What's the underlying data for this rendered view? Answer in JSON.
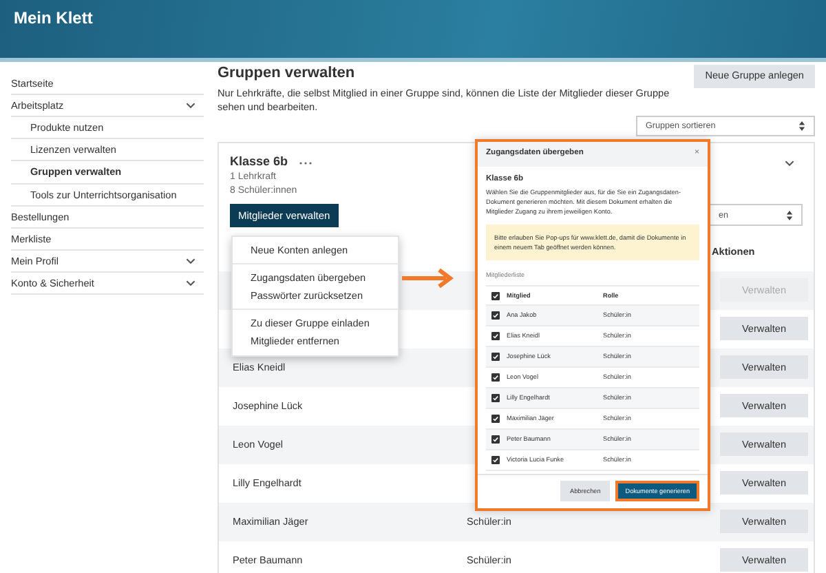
{
  "header": {
    "title": "Mein Klett"
  },
  "sidebar": {
    "items": [
      {
        "label": "Startseite",
        "kind": "link",
        "selected": false
      },
      {
        "label": "Arbeitsplatz",
        "kind": "group",
        "selected": false,
        "children": [
          {
            "label": "Produkte nutzen",
            "selected": false
          },
          {
            "label": "Lizenzen verwalten",
            "selected": false
          },
          {
            "label": "Gruppen verwalten",
            "selected": true
          },
          {
            "label": "Tools zur Unterrichtsorganisation",
            "selected": false
          }
        ]
      },
      {
        "label": "Bestellungen",
        "kind": "link",
        "selected": false
      },
      {
        "label": "Merkliste",
        "kind": "link",
        "selected": false
      },
      {
        "label": "Mein Profil",
        "kind": "group",
        "selected": false
      },
      {
        "label": "Konto & Sicherheit",
        "kind": "group",
        "selected": false
      }
    ]
  },
  "page": {
    "title": "Gruppen verwalten",
    "description": "Nur Lehrkräfte, die selbst Mitglied in einer Gruppe sind, können die Liste der Mitglieder dieser Gruppe sehen und bearbeiten.",
    "new_group_button": "Neue Gruppe anlegen",
    "sort_select": "Gruppen sortieren"
  },
  "group_card": {
    "name": "Klasse 6b",
    "counts": [
      "1 Lehrkraft",
      "8 Schüler:innen"
    ],
    "manage_button": "Mitglieder verwalten",
    "filter_select": "en",
    "table": {
      "columns": [
        {
          "label": "Aktionen"
        }
      ],
      "rows": [
        {
          "action": "Verwalten",
          "disabled": true
        },
        {
          "action": "Verwalten",
          "disabled": false
        },
        {
          "name": "Elias Kneidl",
          "action": "Verwalten",
          "disabled": false
        },
        {
          "name": "Josephine Lück",
          "action": "Verwalten",
          "disabled": false
        },
        {
          "name": "Leon Vogel",
          "action": "Verwalten",
          "disabled": false
        },
        {
          "name": "Lilly Engelhardt",
          "action": "Verwalten",
          "disabled": false
        },
        {
          "name": "Maximilian Jäger",
          "role": "Schüler:in",
          "action": "Verwalten",
          "disabled": false
        },
        {
          "name": "Peter Baumann",
          "role": "Schüler:in",
          "action": "Verwalten",
          "disabled": false
        }
      ]
    }
  },
  "menu": {
    "sections": [
      {
        "items": [
          "Neue Konten anlegen"
        ]
      },
      {
        "items": [
          "Zugangsdaten übergeben",
          "Passwörter zurücksetzen"
        ]
      },
      {
        "items": [
          "Zu dieser Gruppe einladen",
          "Mitglieder entfernen"
        ]
      }
    ]
  },
  "modal": {
    "title": "Zugangsdaten übergeben",
    "close": "×",
    "highlighted": true,
    "group": "Klasse 6b",
    "text": "Wählen Sie die Gruppenmitglieder aus, für die Sie ein Zugangsdaten-Dokument generieren möchten. Mit diesem Dokument erhalten die Mitglieder Zugang zu ihrem jeweiligen Konto.",
    "alert": "Bitte erlauben Sie Pop-ups für www.klett.de, damit die Dokumente in einem neuem Tab geöffnet werden können.",
    "list_label": "Mitgliederliste",
    "columns": [
      "Mitglied",
      "Rolle"
    ],
    "all_checked": true,
    "members": [
      {
        "name": "Ana Jakob",
        "role": "Schüler:in",
        "checked": true
      },
      {
        "name": "Elias Kneidl",
        "role": "Schüler:in",
        "checked": true
      },
      {
        "name": "Josephine Lück",
        "role": "Schüler:in",
        "checked": true
      },
      {
        "name": "Leon Vogel",
        "role": "Schüler:in",
        "checked": true
      },
      {
        "name": "Lilly Engelhardt",
        "role": "Schüler:in",
        "checked": true
      },
      {
        "name": "Maximilian Jäger",
        "role": "Schüler:in",
        "checked": true
      },
      {
        "name": "Peter Baumann",
        "role": "Schüler:in",
        "checked": true
      },
      {
        "name": "Victoria Lucia Funke",
        "role": "Schüler:in",
        "checked": true
      }
    ],
    "buttons": [
      {
        "label": "Abbrechen",
        "kind": "secondary",
        "highlighted": false
      },
      {
        "label": "Dokumente generieren",
        "kind": "primary",
        "highlighted": true
      }
    ]
  }
}
